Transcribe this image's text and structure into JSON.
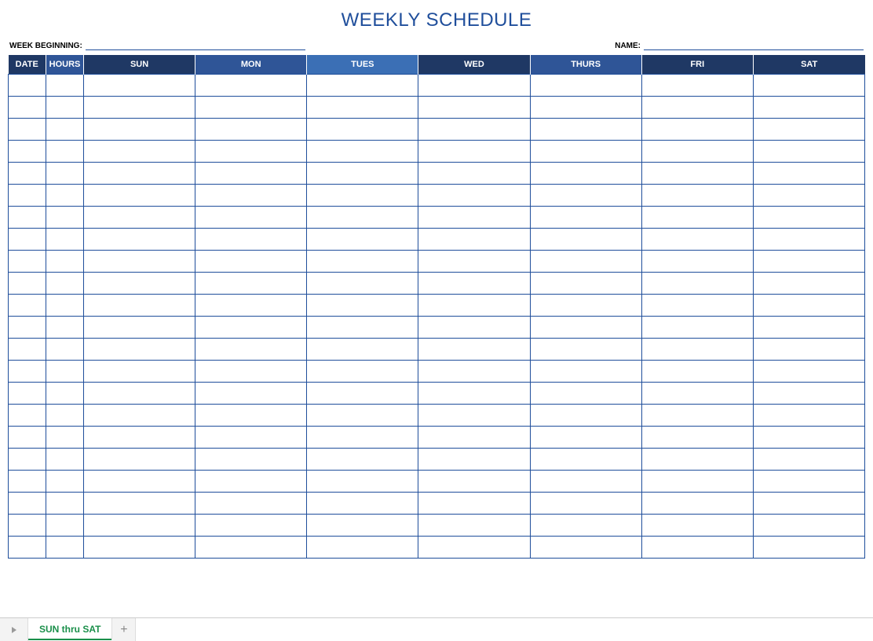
{
  "title": "WEEKLY SCHEDULE",
  "meta": {
    "week_beginning_label": "WEEK BEGINNING:",
    "week_beginning_value": "",
    "name_label": "NAME:",
    "name_value": ""
  },
  "headers": {
    "date": "DATE",
    "hours": "HOURS",
    "days": [
      "SUN",
      "MON",
      "TUES",
      "WED",
      "THURS",
      "FRI",
      "SAT"
    ]
  },
  "rows": [
    {
      "date": "",
      "hours": "",
      "sun": "",
      "mon": "",
      "tues": "",
      "wed": "",
      "thurs": "",
      "fri": "",
      "sat": ""
    },
    {
      "date": "",
      "hours": "",
      "sun": "",
      "mon": "",
      "tues": "",
      "wed": "",
      "thurs": "",
      "fri": "",
      "sat": ""
    },
    {
      "date": "",
      "hours": "",
      "sun": "",
      "mon": "",
      "tues": "",
      "wed": "",
      "thurs": "",
      "fri": "",
      "sat": ""
    },
    {
      "date": "",
      "hours": "",
      "sun": "",
      "mon": "",
      "tues": "",
      "wed": "",
      "thurs": "",
      "fri": "",
      "sat": ""
    },
    {
      "date": "",
      "hours": "",
      "sun": "",
      "mon": "",
      "tues": "",
      "wed": "",
      "thurs": "",
      "fri": "",
      "sat": ""
    },
    {
      "date": "",
      "hours": "",
      "sun": "",
      "mon": "",
      "tues": "",
      "wed": "",
      "thurs": "",
      "fri": "",
      "sat": ""
    },
    {
      "date": "",
      "hours": "",
      "sun": "",
      "mon": "",
      "tues": "",
      "wed": "",
      "thurs": "",
      "fri": "",
      "sat": ""
    },
    {
      "date": "",
      "hours": "",
      "sun": "",
      "mon": "",
      "tues": "",
      "wed": "",
      "thurs": "",
      "fri": "",
      "sat": ""
    },
    {
      "date": "",
      "hours": "",
      "sun": "",
      "mon": "",
      "tues": "",
      "wed": "",
      "thurs": "",
      "fri": "",
      "sat": ""
    },
    {
      "date": "",
      "hours": "",
      "sun": "",
      "mon": "",
      "tues": "",
      "wed": "",
      "thurs": "",
      "fri": "",
      "sat": ""
    },
    {
      "date": "",
      "hours": "",
      "sun": "",
      "mon": "",
      "tues": "",
      "wed": "",
      "thurs": "",
      "fri": "",
      "sat": ""
    },
    {
      "date": "",
      "hours": "",
      "sun": "",
      "mon": "",
      "tues": "",
      "wed": "",
      "thurs": "",
      "fri": "",
      "sat": ""
    },
    {
      "date": "",
      "hours": "",
      "sun": "",
      "mon": "",
      "tues": "",
      "wed": "",
      "thurs": "",
      "fri": "",
      "sat": ""
    },
    {
      "date": "",
      "hours": "",
      "sun": "",
      "mon": "",
      "tues": "",
      "wed": "",
      "thurs": "",
      "fri": "",
      "sat": ""
    },
    {
      "date": "",
      "hours": "",
      "sun": "",
      "mon": "",
      "tues": "",
      "wed": "",
      "thurs": "",
      "fri": "",
      "sat": ""
    },
    {
      "date": "",
      "hours": "",
      "sun": "",
      "mon": "",
      "tues": "",
      "wed": "",
      "thurs": "",
      "fri": "",
      "sat": ""
    },
    {
      "date": "",
      "hours": "",
      "sun": "",
      "mon": "",
      "tues": "",
      "wed": "",
      "thurs": "",
      "fri": "",
      "sat": ""
    },
    {
      "date": "",
      "hours": "",
      "sun": "",
      "mon": "",
      "tues": "",
      "wed": "",
      "thurs": "",
      "fri": "",
      "sat": ""
    },
    {
      "date": "",
      "hours": "",
      "sun": "",
      "mon": "",
      "tues": "",
      "wed": "",
      "thurs": "",
      "fri": "",
      "sat": ""
    },
    {
      "date": "",
      "hours": "",
      "sun": "",
      "mon": "",
      "tues": "",
      "wed": "",
      "thurs": "",
      "fri": "",
      "sat": ""
    },
    {
      "date": "",
      "hours": "",
      "sun": "",
      "mon": "",
      "tues": "",
      "wed": "",
      "thurs": "",
      "fri": "",
      "sat": ""
    },
    {
      "date": "",
      "hours": "",
      "sun": "",
      "mon": "",
      "tues": "",
      "wed": "",
      "thurs": "",
      "fri": "",
      "sat": ""
    }
  ],
  "tabbar": {
    "active_sheet": "SUN thru SAT",
    "add_label": "+"
  }
}
